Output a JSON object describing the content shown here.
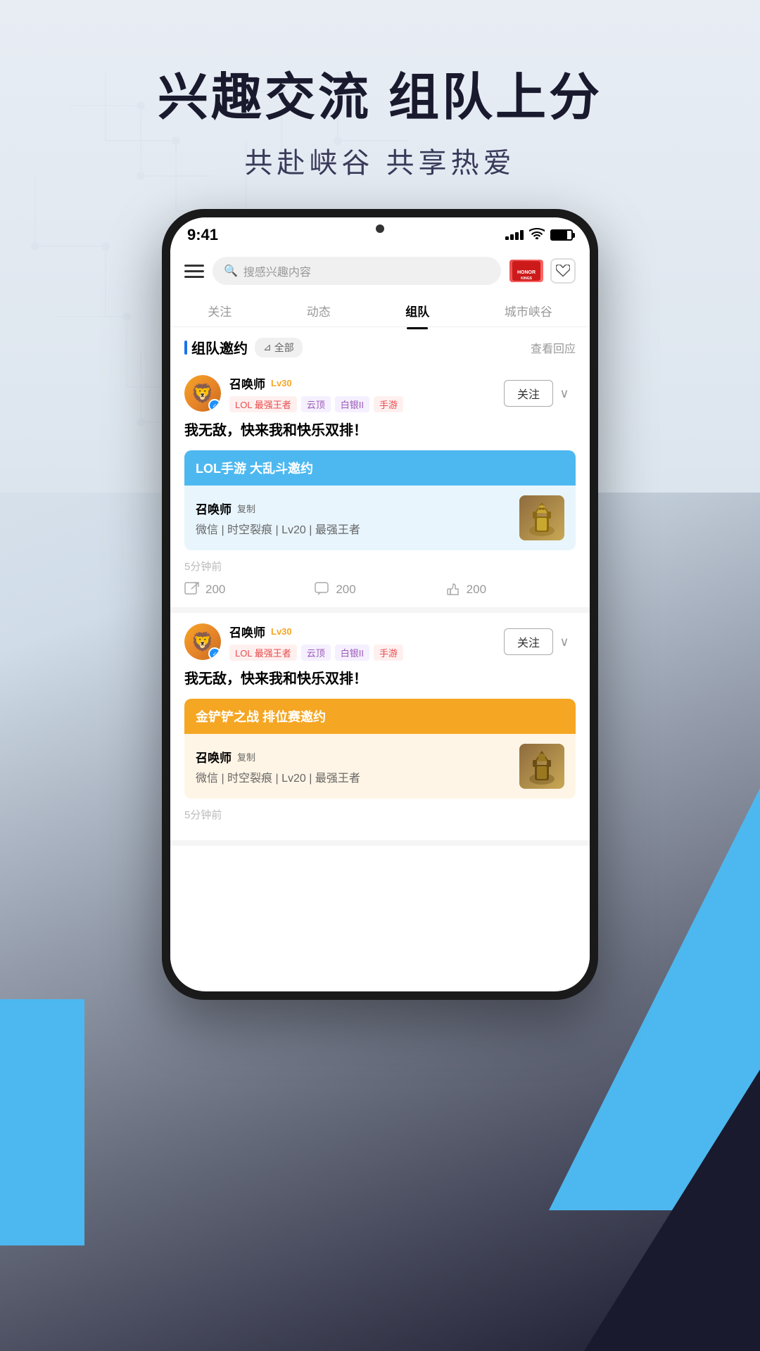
{
  "app": {
    "background_title": "兴趣交流 组队上分",
    "background_subtitle": "共赴峡谷 共享热爱"
  },
  "status_bar": {
    "time": "9:41",
    "signal_bars": [
      3,
      5,
      7,
      9,
      11
    ],
    "battery_percent": 80
  },
  "top_bar": {
    "search_placeholder": "搜感兴趣内容",
    "heart_icon": "❤",
    "menu_icon": "≡"
  },
  "nav_tabs": [
    {
      "label": "关注",
      "active": false
    },
    {
      "label": "动态",
      "active": false
    },
    {
      "label": "组队",
      "active": true
    },
    {
      "label": "城市峡谷",
      "active": false
    }
  ],
  "section": {
    "title": "组队邀约",
    "filter_label": "全部",
    "filter_icon": "▼",
    "see_more": "查看回应"
  },
  "posts": [
    {
      "username": "召唤师",
      "level": "Lv30",
      "tags": [
        "LOL 最强王者",
        "云顶",
        "白银II",
        "手游"
      ],
      "tag_types": [
        "lol",
        "rank",
        "server",
        "mobile"
      ],
      "content": "我无敌，快来我和快乐双排！",
      "follow_label": "关注",
      "invite_card": {
        "header": "LOL手游  大乱斗邀约",
        "color": "blue",
        "body_username": "召唤师",
        "copy_label": "复制",
        "details": "微信 | 时空裂痕 | Lv20 | 最强王者"
      },
      "time": "5分钟前",
      "actions": [
        {
          "icon": "share",
          "count": "200"
        },
        {
          "icon": "comment",
          "count": "200"
        },
        {
          "icon": "like",
          "count": "200"
        }
      ]
    },
    {
      "username": "召唤师",
      "level": "Lv30",
      "tags": [
        "LOL 最强王者",
        "云顶",
        "白银II",
        "手游"
      ],
      "tag_types": [
        "lol",
        "rank",
        "server",
        "mobile"
      ],
      "content": "我无敌，快来我和快乐双排！",
      "follow_label": "关注",
      "invite_card": {
        "header": "金铲铲之战  排位赛邀约",
        "color": "orange",
        "body_username": "召唤师",
        "copy_label": "复制",
        "details": "微信 | 时空裂痕 | Lv20 | 最强王者"
      },
      "time": "5分钟前",
      "actions": []
    }
  ]
}
